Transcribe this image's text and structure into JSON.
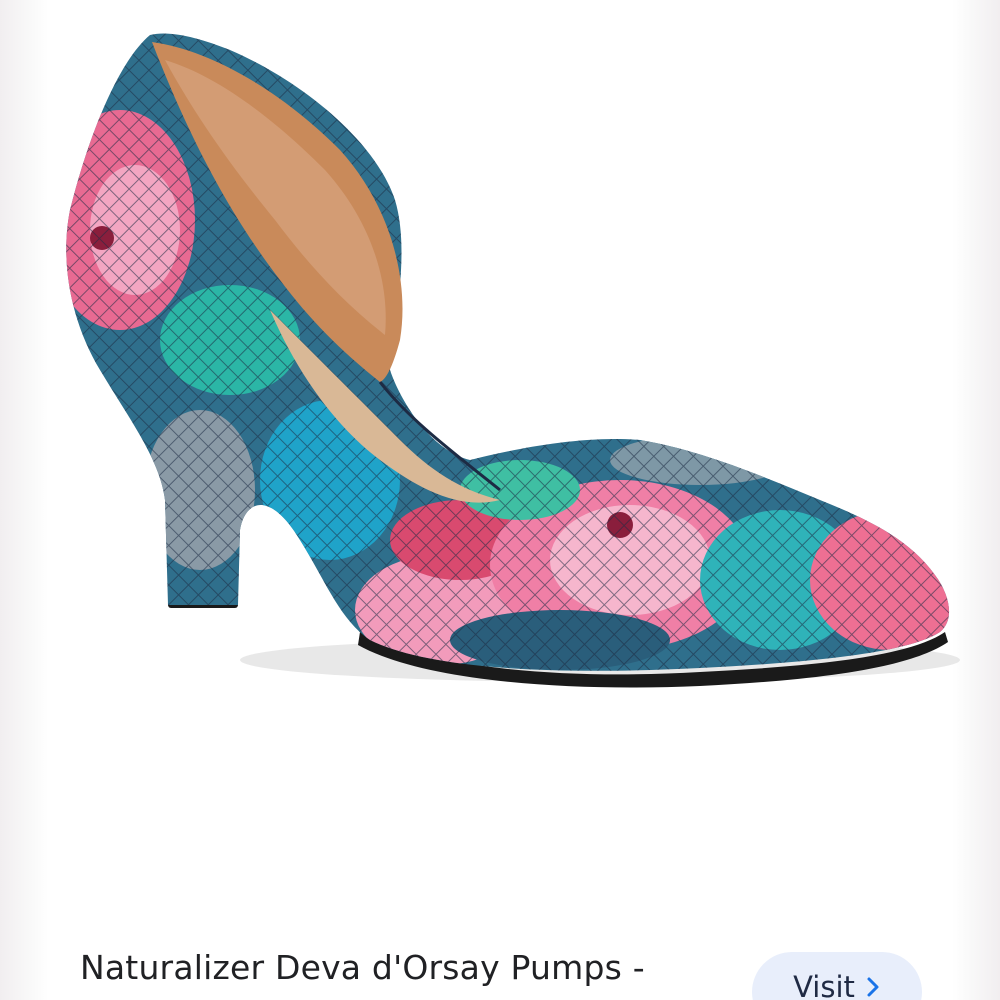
{
  "product": {
    "image_alt": "Floral snake-embossed d'Orsay pump",
    "title": "Naturalizer Deva d'Orsay Pumps -"
  },
  "actions": {
    "visit_label": "Visit"
  },
  "icons": {
    "visit_chevron": "chevron-right-icon"
  },
  "colors": {
    "button_bg": "#e8eefb",
    "title_text": "#202124",
    "link_chevron": "#1a73e8"
  }
}
